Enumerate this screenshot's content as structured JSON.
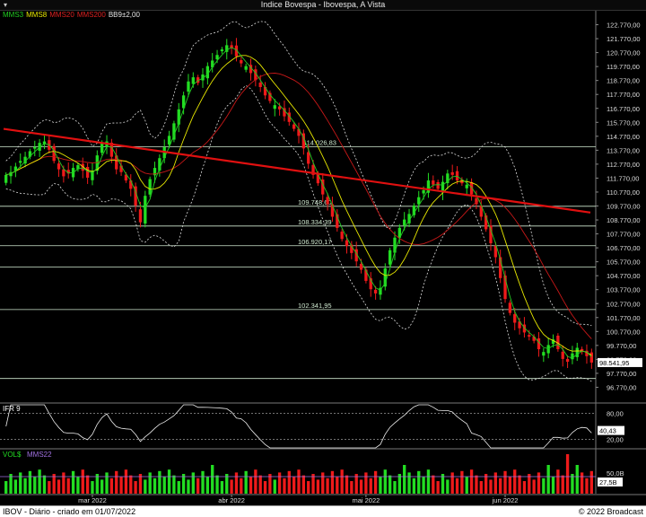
{
  "window": {
    "title": "Indice Bovespa - Ibovespa, A Vista",
    "collapse_glyph": "▾"
  },
  "legend": [
    {
      "label": "MMS3",
      "color": "#22cc22"
    },
    {
      "label": "MMS8",
      "color": "#e8e800"
    },
    {
      "label": "MMS20",
      "color": "#dd2020"
    },
    {
      "label": "MMS200",
      "color": "#dd2020"
    },
    {
      "label": "BB9±2,00",
      "color": "#e8e8e8"
    }
  ],
  "colors": {
    "up": "#22dd22",
    "down": "#ee1a1a",
    "mms3": "#22cc22",
    "mms8": "#e8e800",
    "mms20": "#c81818",
    "mms200": "#e01010",
    "bb": "#dddddd",
    "level": "#cfe8cf"
  },
  "chart_data": [
    {
      "type": "candlestick",
      "title": "",
      "ylim": [
        95770,
        123770
      ],
      "yticks": [
        "122.770,00",
        "121.770,00",
        "120.770,00",
        "119.770,00",
        "118.770,00",
        "117.770,00",
        "116.770,00",
        "115.770,00",
        "114.770,00",
        "113.770,00",
        "112.770,00",
        "111.770,00",
        "110.770,00",
        "109.770,00",
        "108.770,00",
        "107.770,00",
        "106.770,00",
        "105.770,00",
        "104.770,00",
        "103.770,00",
        "102.770,00",
        "101.770,00",
        "100.770,00",
        "99.770,00",
        "98.770,00",
        "97.770,00",
        "96.770,00"
      ],
      "x_labels": [
        {
          "label": "mar 2022",
          "index": 18
        },
        {
          "label": "abr 2022",
          "index": 47
        },
        {
          "label": "mai 2022",
          "index": 75
        },
        {
          "label": "jun 2022",
          "index": 104
        }
      ],
      "last_value": "98.541,95",
      "levels": [
        {
          "value": 114026.83,
          "label": "114.026,83"
        },
        {
          "value": 109748.6,
          "label": "109.748,60"
        },
        {
          "value": 108334.39,
          "label": "108.334,39"
        },
        {
          "value": 106920.17,
          "label": "106.920,17"
        },
        {
          "value": 105400,
          "label": ""
        },
        {
          "value": 102341.95,
          "label": "102.341,95"
        },
        {
          "value": 97400,
          "label": ""
        }
      ],
      "closes": [
        112000,
        112200,
        112600,
        113000,
        113300,
        113700,
        114000,
        114300,
        114400,
        113800,
        113000,
        112400,
        111900,
        112100,
        112500,
        112700,
        112300,
        111800,
        112300,
        113400,
        114300,
        114400,
        113300,
        112400,
        112200,
        111600,
        111000,
        109800,
        108600,
        110500,
        111700,
        112500,
        113200,
        114000,
        114800,
        115700,
        116700,
        117700,
        118700,
        119000,
        118600,
        119200,
        119800,
        120200,
        120600,
        121000,
        121300,
        121100,
        120500,
        120000,
        119800,
        119300,
        118800,
        118300,
        117700,
        117300,
        117000,
        116700,
        116200,
        115800,
        115300,
        114800,
        113900,
        112800,
        112000,
        111400,
        110600,
        109900,
        109000,
        108200,
        107400,
        106900,
        106400,
        105800,
        105200,
        104400,
        103800,
        103500,
        103900,
        105300,
        106600,
        107500,
        108200,
        108800,
        109200,
        109800,
        110400,
        110900,
        111600,
        111300,
        111000,
        111500,
        112100,
        112000,
        111600,
        111400,
        111300,
        110600,
        109900,
        109000,
        108100,
        107100,
        106100,
        104600,
        103100,
        102100,
        101400,
        101000,
        100700,
        100400,
        100100,
        99500,
        99300,
        99800,
        100200,
        99500,
        98800,
        98600,
        99200,
        99600,
        99300,
        99000,
        98542
      ],
      "mms200": {
        "start": 115300,
        "end": 109300
      },
      "ifr": {
        "ylim": [
          0,
          100
        ],
        "yticks": [
          "80,00",
          "20,00"
        ],
        "last_value": "40,43"
      },
      "volume": {
        "label": "VOL$",
        "ma_label": "MMS22",
        "ytick": "50,0B",
        "last_value": "27,5B"
      }
    }
  ],
  "footer": {
    "left": "IBOV - Diário - criado em 01/07/2022",
    "right": "© 2022 Broadcast"
  }
}
